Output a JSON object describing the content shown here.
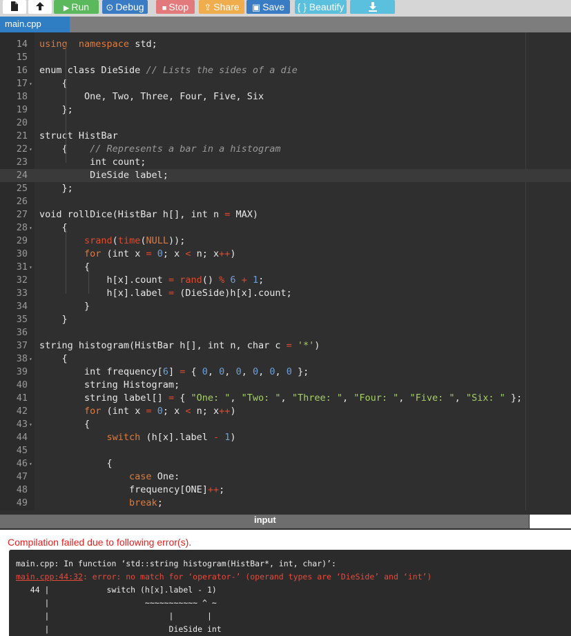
{
  "toolbar": {
    "file_icon": "file-icon",
    "upload_icon": "upload-icon",
    "run": {
      "label": "Run",
      "icon": "play-icon",
      "color": "#5cb85c"
    },
    "debug": {
      "label": "Debug",
      "icon": "bug-icon",
      "color": "#3a7cc4"
    },
    "stop": {
      "label": "Stop",
      "icon": "stop-icon",
      "color": "#e2797a"
    },
    "share": {
      "label": "Share",
      "icon": "share-icon",
      "color": "#f0ad4e"
    },
    "save": {
      "label": "Save",
      "icon": "save-icon",
      "color": "#3a7cc4"
    },
    "beautify": {
      "label": "{ } Beautify",
      "color": "#5bc0de"
    },
    "download": {
      "icon": "download-icon",
      "color": "#5bc0de"
    }
  },
  "tab": {
    "label": "main.cpp",
    "color": "#2f7ec3"
  },
  "editor": {
    "lines": [
      {
        "n": "14",
        "segs": [
          [
            "kw",
            "using"
          ],
          [
            "",
            "  "
          ],
          [
            "kw",
            "namespace"
          ],
          [
            "",
            " std;"
          ]
        ]
      },
      {
        "n": "15",
        "segs": []
      },
      {
        "n": "16",
        "segs": [
          [
            "",
            "enum class DieSide "
          ],
          [
            "cmt",
            "// Lists the sides of a die"
          ]
        ]
      },
      {
        "n": "17",
        "fold": true,
        "segs": [
          [
            "",
            "    {"
          ]
        ]
      },
      {
        "n": "18",
        "segs": [
          [
            "",
            "        One, Two, Three, Four, Five, Six"
          ]
        ]
      },
      {
        "n": "19",
        "segs": [
          [
            "",
            "    };"
          ]
        ]
      },
      {
        "n": "20",
        "segs": []
      },
      {
        "n": "21",
        "segs": [
          [
            "",
            "struct HistBar"
          ]
        ]
      },
      {
        "n": "22",
        "fold": true,
        "segs": [
          [
            "",
            "    {    "
          ],
          [
            "cmt",
            "// Represents a bar in a histogram"
          ]
        ]
      },
      {
        "n": "23",
        "segs": [
          [
            "",
            "         int count;"
          ]
        ]
      },
      {
        "n": "24",
        "active": true,
        "segs": [
          [
            "",
            "         DieSide label;"
          ]
        ]
      },
      {
        "n": "25",
        "segs": [
          [
            "",
            "    };"
          ]
        ]
      },
      {
        "n": "26",
        "segs": []
      },
      {
        "n": "27",
        "segs": [
          [
            "",
            "void rollDice(HistBar h[], int n "
          ],
          [
            "op",
            "="
          ],
          [
            "",
            " MAX)"
          ]
        ]
      },
      {
        "n": "28",
        "fold": true,
        "segs": [
          [
            "",
            "    {"
          ]
        ]
      },
      {
        "n": "29",
        "segs": [
          [
            "",
            "        "
          ],
          [
            "fn",
            "srand"
          ],
          [
            "",
            "("
          ],
          [
            "fn",
            "time"
          ],
          [
            "",
            "("
          ],
          [
            "kw",
            "NULL"
          ],
          [
            "",
            "));"
          ]
        ]
      },
      {
        "n": "30",
        "segs": [
          [
            "",
            "        "
          ],
          [
            "kw",
            "for"
          ],
          [
            "",
            " (int x "
          ],
          [
            "op",
            "="
          ],
          [
            "",
            ""
          ],
          [
            "num",
            " 0"
          ],
          [
            "",
            "; x "
          ],
          [
            "op",
            "<"
          ],
          [
            "",
            " n; x"
          ],
          [
            "op",
            "++"
          ],
          [
            "",
            ")"
          ]
        ]
      },
      {
        "n": "31",
        "fold": true,
        "segs": [
          [
            "",
            "        {"
          ]
        ]
      },
      {
        "n": "32",
        "segs": [
          [
            "",
            "            h[x].count "
          ],
          [
            "op",
            "="
          ],
          [
            "",
            " "
          ],
          [
            "fn",
            "rand"
          ],
          [
            "",
            "() "
          ],
          [
            "op",
            "%"
          ],
          [
            "",
            " "
          ],
          [
            "num",
            "6"
          ],
          [
            "",
            " "
          ],
          [
            "op",
            "+"
          ],
          [
            "",
            " "
          ],
          [
            "num",
            "1"
          ],
          [
            "",
            ";"
          ]
        ]
      },
      {
        "n": "33",
        "segs": [
          [
            "",
            "            h[x].label "
          ],
          [
            "op",
            "="
          ],
          [
            "",
            " (DieSide)h[x].count;"
          ]
        ]
      },
      {
        "n": "34",
        "segs": [
          [
            "",
            "        }"
          ]
        ]
      },
      {
        "n": "35",
        "segs": [
          [
            "",
            "    }"
          ]
        ]
      },
      {
        "n": "36",
        "segs": []
      },
      {
        "n": "37",
        "segs": [
          [
            "",
            "string histogram(HistBar h[], int n, char c "
          ],
          [
            "op",
            "="
          ],
          [
            "",
            " "
          ],
          [
            "str",
            "'*'"
          ],
          [
            "",
            ")"
          ]
        ]
      },
      {
        "n": "38",
        "fold": true,
        "segs": [
          [
            "",
            "    {"
          ]
        ]
      },
      {
        "n": "39",
        "segs": [
          [
            "",
            "        int frequency["
          ],
          [
            "num",
            "6"
          ],
          [
            "",
            "] "
          ],
          [
            "op",
            "="
          ],
          [
            "",
            " { "
          ],
          [
            "num",
            "0"
          ],
          [
            "",
            ", "
          ],
          [
            "num",
            "0"
          ],
          [
            "",
            ", "
          ],
          [
            "num",
            "0"
          ],
          [
            "",
            ", "
          ],
          [
            "num",
            "0"
          ],
          [
            "",
            ", "
          ],
          [
            "num",
            "0"
          ],
          [
            "",
            ", "
          ],
          [
            "num",
            "0"
          ],
          [
            "",
            " };"
          ]
        ]
      },
      {
        "n": "40",
        "segs": [
          [
            "",
            "        string Histogram;"
          ]
        ]
      },
      {
        "n": "41",
        "segs": [
          [
            "",
            "        string label[] "
          ],
          [
            "op",
            "="
          ],
          [
            "",
            " { "
          ],
          [
            "str",
            "\"One: \""
          ],
          [
            "",
            ", "
          ],
          [
            "str",
            "\"Two: \""
          ],
          [
            "",
            ", "
          ],
          [
            "str",
            "\"Three: \""
          ],
          [
            "",
            ", "
          ],
          [
            "str",
            "\"Four: \""
          ],
          [
            "",
            ", "
          ],
          [
            "str",
            "\"Five: \""
          ],
          [
            "",
            ", "
          ],
          [
            "str",
            "\"Six: \""
          ],
          [
            "",
            " };"
          ]
        ]
      },
      {
        "n": "42",
        "segs": [
          [
            "",
            "        "
          ],
          [
            "kw",
            "for"
          ],
          [
            "",
            " (int x "
          ],
          [
            "op",
            "="
          ],
          [
            "",
            " "
          ],
          [
            "num",
            "0"
          ],
          [
            "",
            "; x "
          ],
          [
            "op",
            "<"
          ],
          [
            "",
            " n; x"
          ],
          [
            "op",
            "++"
          ],
          [
            "",
            ")"
          ]
        ]
      },
      {
        "n": "43",
        "fold": true,
        "segs": [
          [
            "",
            "        {"
          ]
        ]
      },
      {
        "n": "44",
        "segs": [
          [
            "",
            "            "
          ],
          [
            "kw",
            "switch"
          ],
          [
            "",
            " (h[x].label "
          ],
          [
            "op",
            "-"
          ],
          [
            "",
            " "
          ],
          [
            "num",
            "1"
          ],
          [
            "",
            ")"
          ]
        ]
      },
      {
        "n": "45",
        "segs": []
      },
      {
        "n": "46",
        "fold": true,
        "segs": [
          [
            "",
            "            {"
          ]
        ]
      },
      {
        "n": "47",
        "segs": [
          [
            "",
            "                "
          ],
          [
            "kw",
            "case"
          ],
          [
            "",
            " One:"
          ]
        ]
      },
      {
        "n": "48",
        "segs": [
          [
            "",
            "                frequency[ONE]"
          ],
          [
            "op",
            "++"
          ],
          [
            "",
            ";"
          ]
        ]
      },
      {
        "n": "49",
        "segs": [
          [
            "",
            "                "
          ],
          [
            "kw",
            "break"
          ],
          [
            "",
            ";"
          ]
        ]
      }
    ]
  },
  "splitter": {
    "label": "input",
    "collapse_icon": "chevron-down-icon",
    "expand_icon": "expand-icon"
  },
  "output": {
    "title": "Compilation failed due to following error(s).",
    "line1": "main.cpp: In function ‘std::string histogram(HistBar*, int, char)’:",
    "error_location": "main.cpp:44:32",
    "error_msg": ": error: no match for ‘operator-’ (operand types are ‘DieSide’ and ‘int’)",
    "line3": "   44 |            switch (h[x].label - 1)",
    "line4": "      |                    ~~~~~~~~~~~ ^ ~",
    "line5": "      |                         |       |",
    "line6": "      |                         DieSide int"
  }
}
